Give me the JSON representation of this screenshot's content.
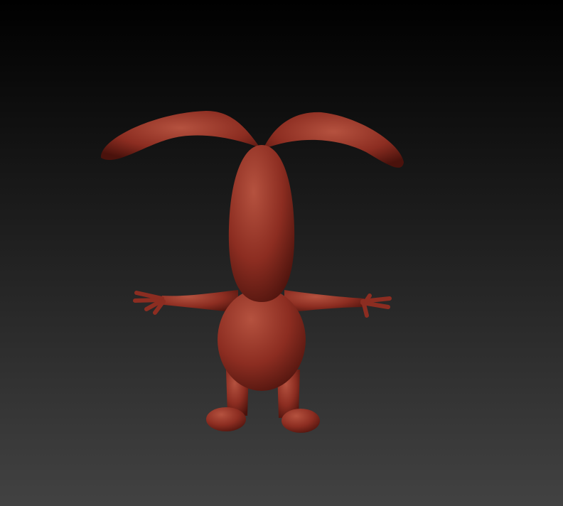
{
  "viewport": {
    "background_top": "#000000",
    "background_bottom": "#424242",
    "model_color": "#8c2d21",
    "model_highlight": "#b5523f",
    "model_shadow": "#4a120c"
  }
}
